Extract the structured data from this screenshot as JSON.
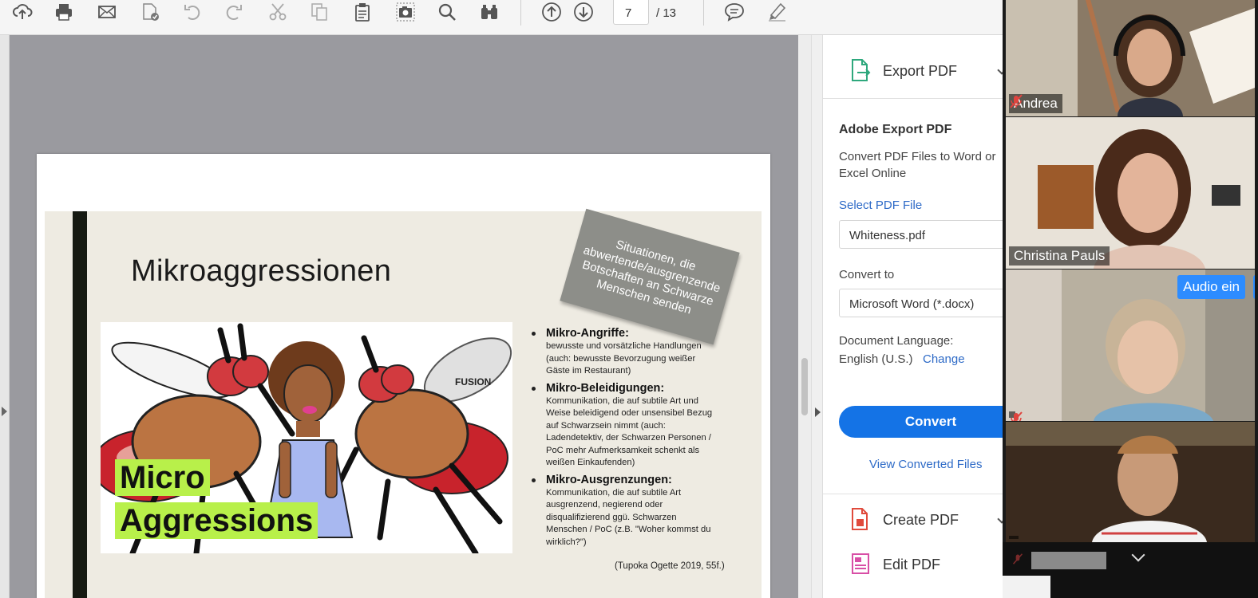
{
  "toolbar": {
    "page_current": "7",
    "page_total": "/ 13"
  },
  "slide": {
    "title": "Mikroaggressionen",
    "note": "Situationen, die abwertende/ausgrenzende Botschaften an Schwarze Menschen senden",
    "image_text_1": "Micro",
    "image_text_2": "Aggressions",
    "image_logo": "FUSION",
    "bullets": [
      {
        "head": "Mikro-Angriffe:",
        "lines": [
          "bewusste und vorsätzliche Handlungen",
          "(auch: bewusste Bevorzugung weißer",
          "Gäste im Restaurant)"
        ]
      },
      {
        "head": "Mikro-Beleidigungen:",
        "lines": [
          "Kommunikation, die auf subtile Art und",
          "Weise beleidigend oder unsensibel Bezug",
          "auf Schwarzsein nimmt (auch:",
          "Ladendetektiv, der Schwarzen Personen /",
          "PoC mehr Aufmerksamkeit schenkt als",
          "weißen Einkaufenden)"
        ]
      },
      {
        "head": "Mikro-Ausgrenzungen:",
        "lines": [
          "Kommunikation, die auf subtile Art",
          "ausgrenzend, negierend oder",
          "disqualifizierend ggü. Schwarzen",
          "Menschen / PoC (z.B. \"Woher kommst du",
          "wirklich?\")"
        ]
      }
    ],
    "citation": "(Tupoka Ogette 2019, 55f.)"
  },
  "right_panel": {
    "export_label": "Export PDF",
    "heading": "Adobe Export PDF",
    "description": "Convert PDF Files to Word or Excel Online",
    "select_label": "Select PDF File",
    "file_name": "Whiteness.pdf",
    "convert_to_label": "Convert to",
    "convert_format": "Microsoft Word (*.docx)",
    "doc_language_label": "Document Language:",
    "doc_language": "English (U.S.)",
    "change_label": "Change",
    "convert_button": "Convert",
    "view_converted": "View Converted Files",
    "create_pdf": "Create PDF",
    "edit_pdf": "Edit PDF"
  },
  "zoom": {
    "participants": [
      {
        "name": "Andrea",
        "muted": true
      },
      {
        "name": "Christina Pauls",
        "muted": false,
        "active": true
      },
      {
        "name": "",
        "muted": true
      },
      {
        "name": "",
        "muted": false
      }
    ],
    "audio_button": "Audio ein"
  },
  "colors": {
    "accent_blue": "#1473e6",
    "link_blue": "#2d6ac7",
    "zoom_blue": "#2d8cff",
    "highlight_green": "#b8f04a",
    "active_speaker": "#7dc04a"
  }
}
